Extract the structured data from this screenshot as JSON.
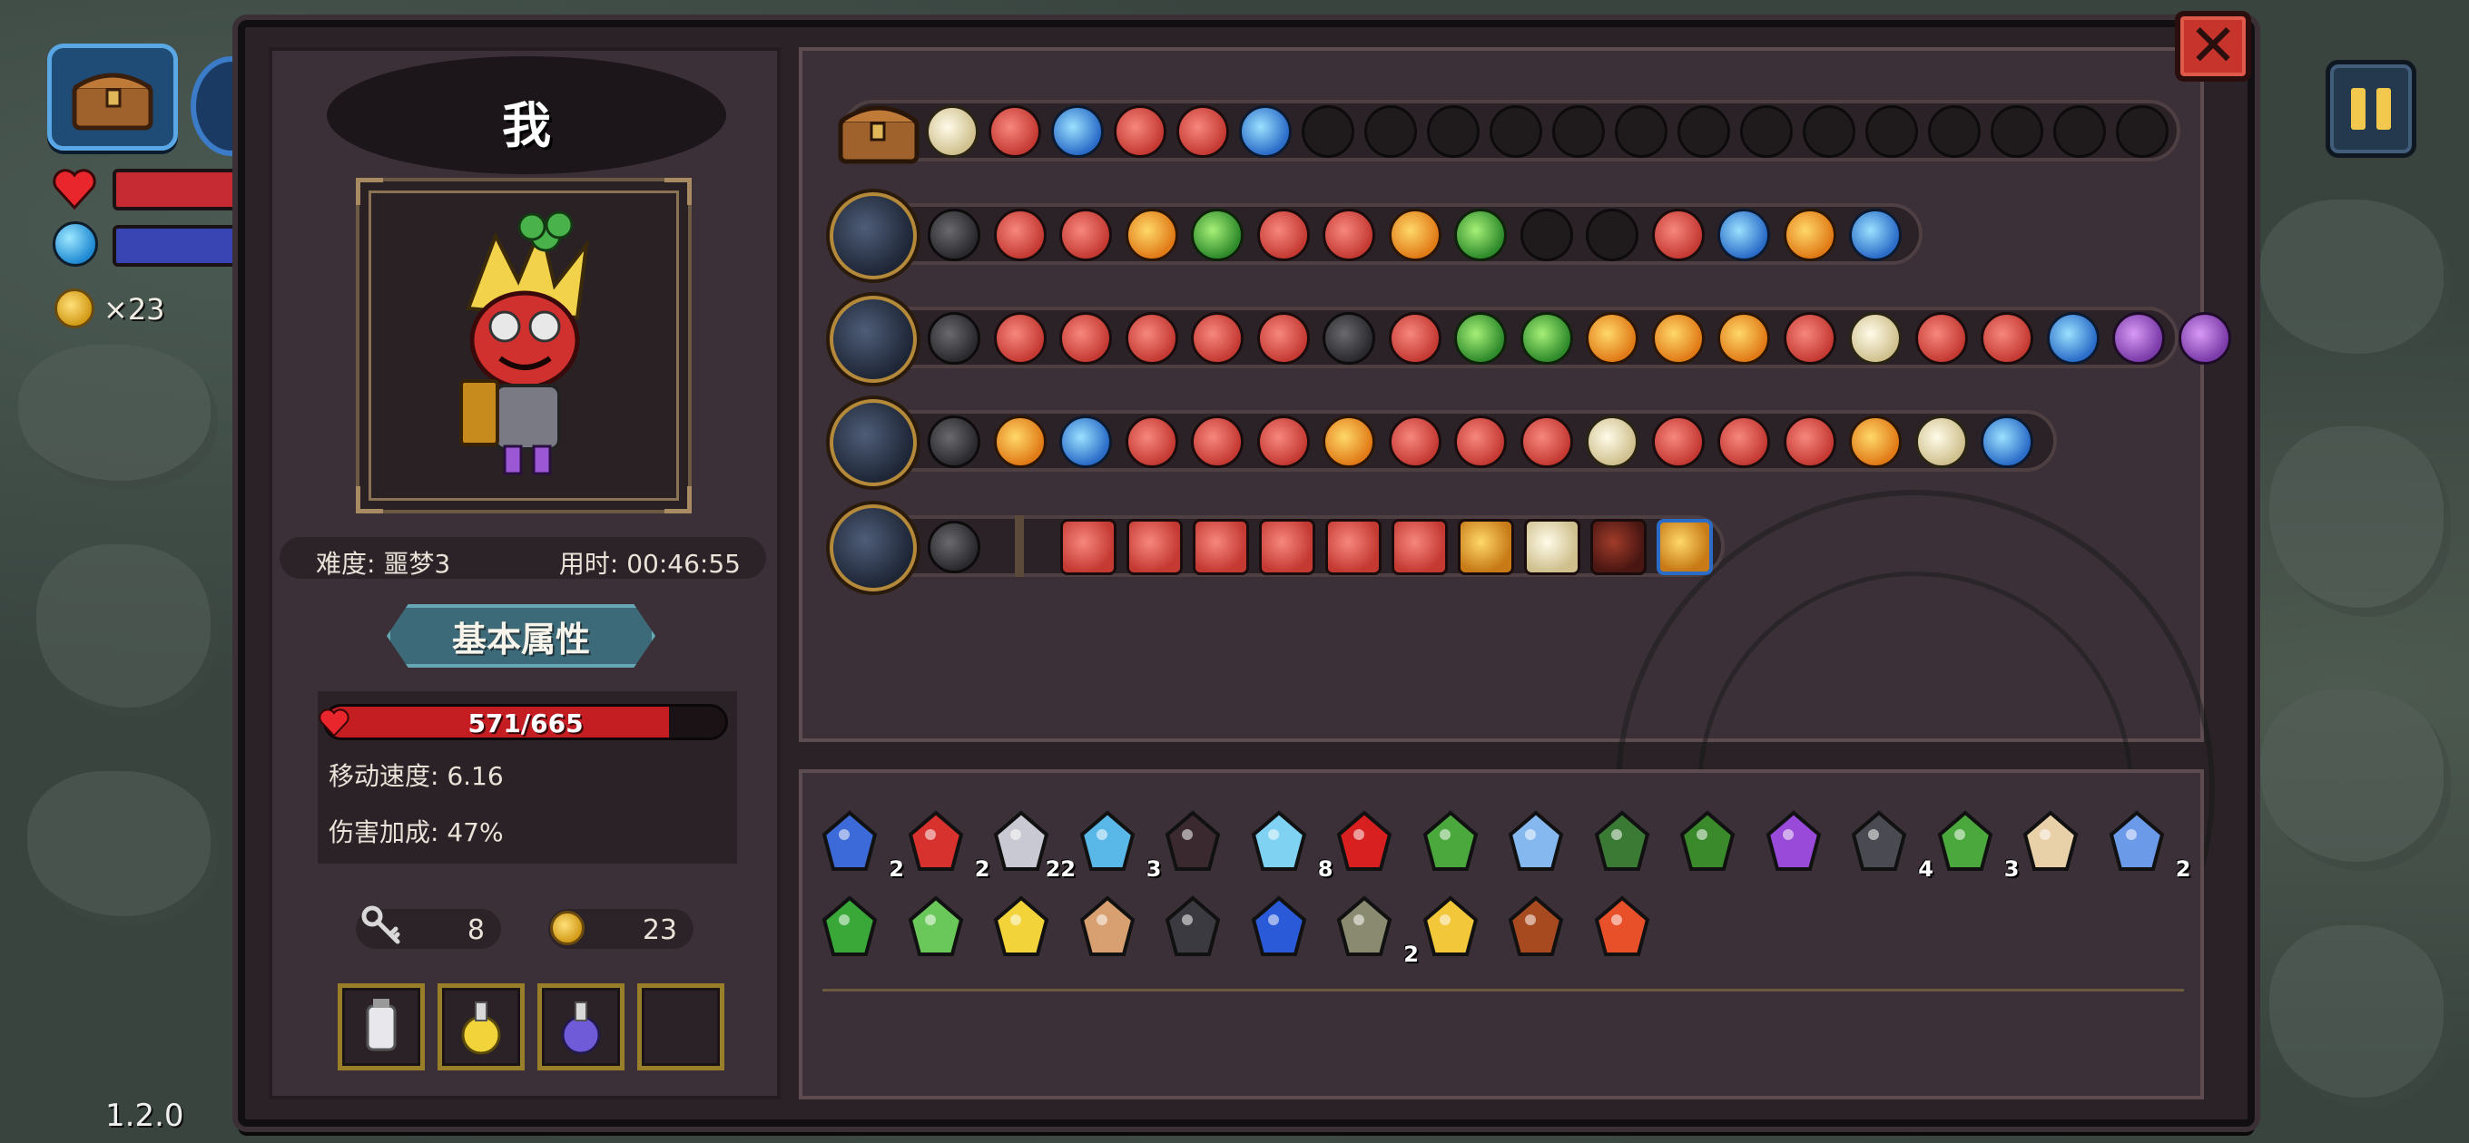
{
  "hud": {
    "coin_count": "×23",
    "version": "1.2.0",
    "icons": [
      "chest-icon",
      "weapon-icon",
      "heart-icon",
      "mana-orb-icon",
      "coin-icon",
      "pause-icon"
    ]
  },
  "window": {
    "close_label": "✕"
  },
  "character": {
    "name": "我",
    "difficulty": "难度: 噩梦3",
    "time": "用时: 00:46:55",
    "attr_tab": "基本属性",
    "hp_text": "571/665",
    "hp_current": 571,
    "hp_max": 665,
    "move_speed": "移动速度: 6.16",
    "damage_bonus": "伤害加成: 47%",
    "keys": "8",
    "coins": "23"
  },
  "colors": {
    "frame_bg": "#2a2226",
    "panel_bg": "#3b3037",
    "hp_red": "#c51e22",
    "accent_teal": "#3d6a78",
    "gold_border": "#9a7f2b"
  },
  "loadout": {
    "chest_row": [
      "cream",
      "red",
      "blue",
      "red",
      "red",
      "blue"
    ],
    "weapon_rows": [
      [
        "dark",
        "red",
        "red",
        "orange",
        "green",
        "red",
        "red",
        "orange",
        "green",
        "empty",
        "empty",
        "red",
        "blue",
        "orange",
        "blue"
      ],
      [
        "dark",
        "red",
        "red",
        "red",
        "red",
        "red",
        "dark",
        "red",
        "green",
        "green",
        "orange",
        "orange",
        "orange",
        "red",
        "cream",
        "red",
        "red",
        "blue",
        "purple",
        "purple"
      ],
      [
        "dark",
        "orange",
        "blue",
        "red",
        "red",
        "red",
        "orange",
        "red",
        "red",
        "red",
        "cream",
        "red",
        "red",
        "red",
        "orange",
        "cream",
        "blue"
      ],
      [
        "dark"
      ]
    ],
    "last_row_squares": [
      "red",
      "red",
      "red",
      "red",
      "red",
      "red",
      "gold",
      "cream",
      "darkred",
      "blueb"
    ]
  },
  "items": {
    "row1": [
      {
        "icon": "squid-icon",
        "count": "2"
      },
      {
        "icon": "demon-mask-icon",
        "count": "2"
      },
      {
        "icon": "arrow-icon",
        "count": "22"
      },
      {
        "icon": "blue-arrow-icon",
        "count": "3"
      },
      {
        "icon": "dark-amulet-icon",
        "count": ""
      },
      {
        "icon": "ice-arrow-icon",
        "count": "8"
      },
      {
        "icon": "red-eye-icon",
        "count": ""
      },
      {
        "icon": "green-leaf-icon",
        "count": ""
      },
      {
        "icon": "blue-flower-icon",
        "count": ""
      },
      {
        "icon": "green-scroll-icon",
        "count": ""
      },
      {
        "icon": "green-hat-icon",
        "count": ""
      },
      {
        "icon": "purple-boot-icon",
        "count": ""
      },
      {
        "icon": "plus-arrow-icon",
        "count": "4"
      },
      {
        "icon": "green-arrow-icon",
        "count": "3"
      },
      {
        "icon": "glasses-icon",
        "count": ""
      },
      {
        "icon": "blue-gem-icon",
        "count": "2"
      }
    ],
    "row2": [
      {
        "icon": "clover-icon",
        "count": ""
      },
      {
        "icon": "syringe-icon",
        "count": ""
      },
      {
        "icon": "candy-corn-icon",
        "count": ""
      },
      {
        "icon": "seed-icon",
        "count": ""
      },
      {
        "icon": "tentacle-icon",
        "count": ""
      },
      {
        "icon": "blue-potion-icon",
        "count": ""
      },
      {
        "icon": "dagger-icon",
        "count": "2"
      },
      {
        "icon": "gold-flame-icon",
        "count": ""
      },
      {
        "icon": "crate-icon",
        "count": ""
      },
      {
        "icon": "fire-arrow-icon",
        "count": ""
      }
    ]
  }
}
